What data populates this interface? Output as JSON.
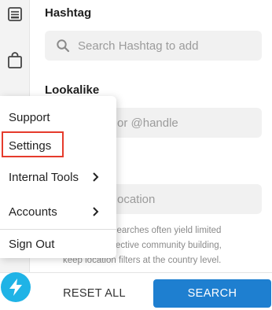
{
  "hashtag": {
    "title": "Hashtag",
    "placeholder": "Search Hashtag to add"
  },
  "lookalike": {
    "title": "Lookalike",
    "placeholder": "or @handle"
  },
  "location": {
    "placeholder": "ocation"
  },
  "note_lines": [
    "tion searches often yield limited",
    "or effective community building,",
    "keep location filters at the country level."
  ],
  "menu": {
    "support": "Support",
    "settings": "Settings",
    "internal_tools": "Internal Tools",
    "accounts": "Accounts",
    "sign_out": "Sign Out"
  },
  "footer": {
    "reset_label": "RESET ALL",
    "search_label": "SEARCH"
  },
  "colors": {
    "primary": "#1e7fd0",
    "logo": "#1fb3e6",
    "highlight": "#e53b2c"
  },
  "icons": {
    "rail_top": "list-icon",
    "rail_second": "shopping-bag-icon",
    "logo": "lightning-bolt-icon",
    "search": "magnifier-icon",
    "submenu": "chevron-right-icon"
  }
}
